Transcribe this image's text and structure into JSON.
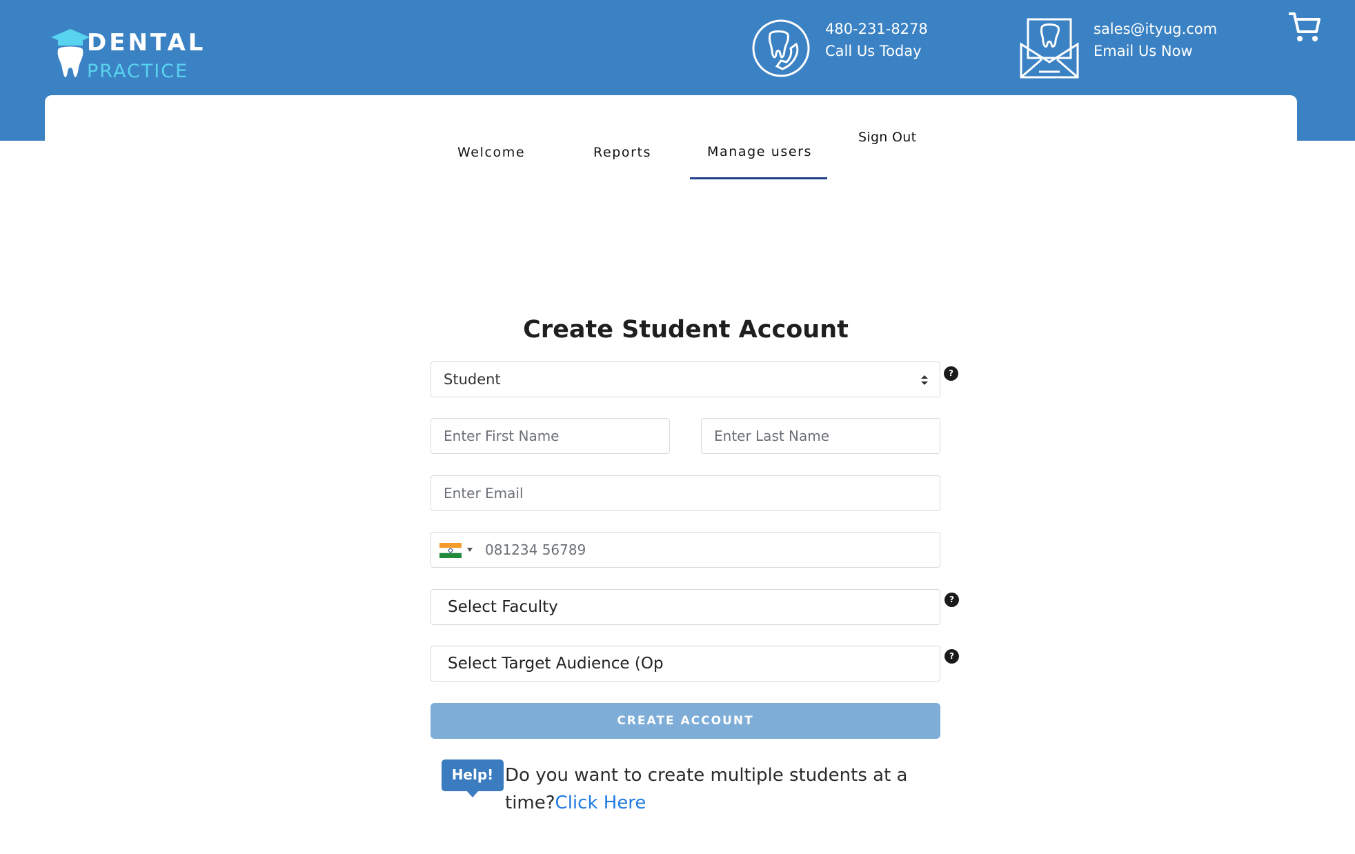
{
  "brand": {
    "logo_line1": "DENTAL",
    "logo_line2": "PRACTICE",
    "accent_color": "#3b82c4",
    "logo_accent": "#58d3f0"
  },
  "contact": {
    "phone": "480-231-8278",
    "phone_caption": "Call Us Today",
    "phone_icon": "tooth-phone-icon",
    "email": "sales@ityug.com",
    "email_caption": "Email Us Now",
    "email_icon": "tooth-envelope-icon"
  },
  "cart": {
    "icon": "cart-icon"
  },
  "nav": {
    "tabs": [
      {
        "label": "Welcome"
      },
      {
        "label": "Reports"
      },
      {
        "label": "Manage users",
        "active": true
      },
      {
        "label": "Sign Out"
      }
    ],
    "active_underline_color": "#1f3f8a"
  },
  "form": {
    "title": "Create Student Account",
    "role_select": {
      "value": "Student"
    },
    "first_name": {
      "placeholder": "Enter First Name",
      "value": ""
    },
    "last_name": {
      "placeholder": "Enter Last Name",
      "value": ""
    },
    "email": {
      "placeholder": "Enter Email",
      "value": ""
    },
    "phone": {
      "placeholder": "081234 56789",
      "country": "India",
      "flag_icon": "india-flag-icon"
    },
    "faculty_select": {
      "value": "Select Faculty"
    },
    "audience_select": {
      "value": "Select Target Audience (Op"
    },
    "help_q": "?",
    "submit_label": "CREATE ACCOUNT",
    "submit_color": "#7eadd8"
  },
  "help": {
    "badge": "Help!",
    "question": "Do you want to create multiple students at a time?",
    "link_label": "Click Here"
  }
}
